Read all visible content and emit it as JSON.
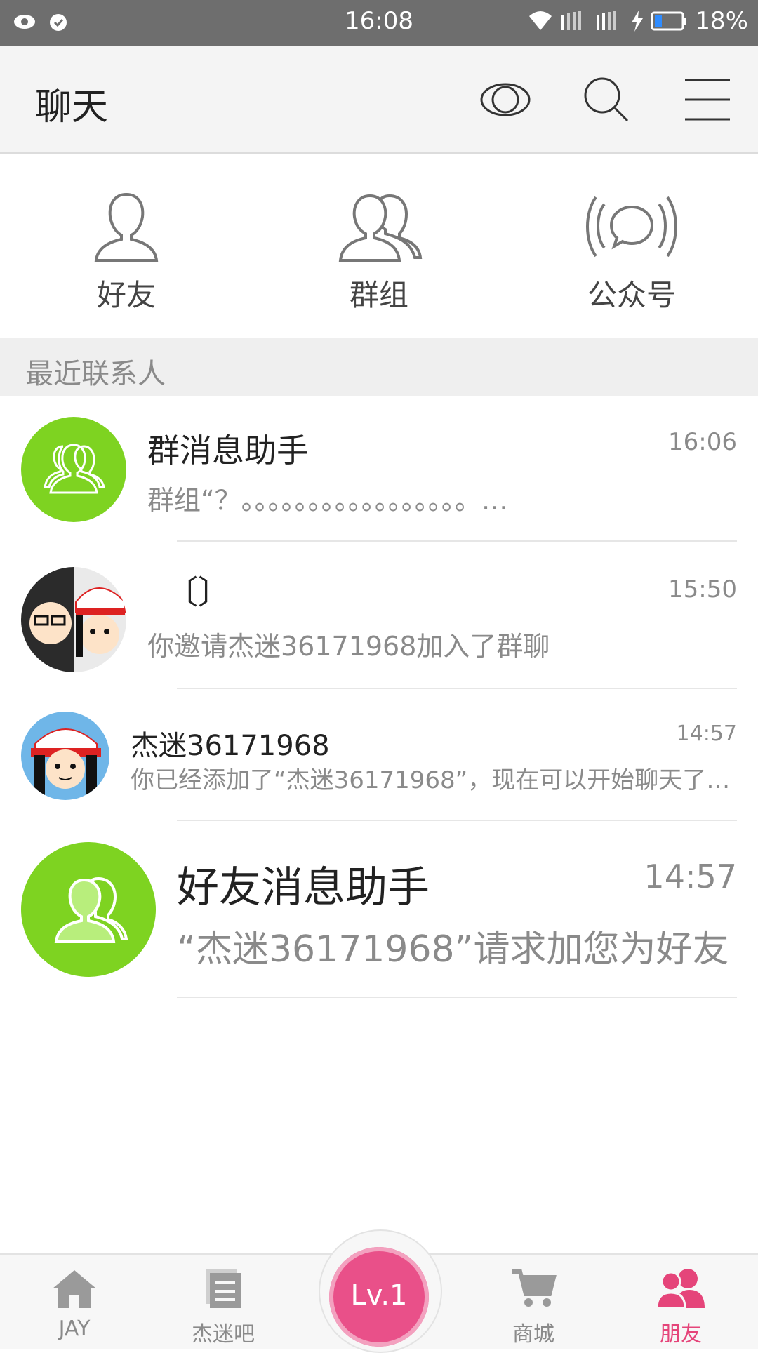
{
  "status_bar": {
    "time": "16:08",
    "battery": "18%"
  },
  "header": {
    "title": "聊天"
  },
  "quick_entries": [
    {
      "label": "好友",
      "icon": "person-icon"
    },
    {
      "label": "群组",
      "icon": "group-icon"
    },
    {
      "label": "公众号",
      "icon": "broadcast-icon"
    }
  ],
  "section": {
    "recent_contacts": "最近联系人"
  },
  "conversations": [
    {
      "name": "群消息助手",
      "time": "16:06",
      "preview": "群组“？。。。。。。。。。。。。。。。。。…"
    },
    {
      "name": "〔〕",
      "time": "15:50",
      "preview": "你邀请杰迷36171968加入了群聊"
    },
    {
      "name": "杰迷36171968",
      "time": "14:57",
      "preview": "你已经添加了“杰迷36171968”，现在可以开始聊天了…"
    },
    {
      "name": "好友消息助手",
      "time": "14:57",
      "preview": "“杰迷36171968”请求加您为好友"
    }
  ],
  "bottom_nav": {
    "items": [
      {
        "label": "JAY",
        "icon": "home-icon"
      },
      {
        "label": "杰迷吧",
        "icon": "document-icon"
      },
      {
        "label": "商城",
        "icon": "cart-icon"
      },
      {
        "label": "朋友",
        "icon": "friends-icon"
      }
    ],
    "level": "Lv.1"
  },
  "colors": {
    "accent": "#e5457a",
    "green": "#7ed321",
    "header_bg": "#f4f4f4"
  }
}
